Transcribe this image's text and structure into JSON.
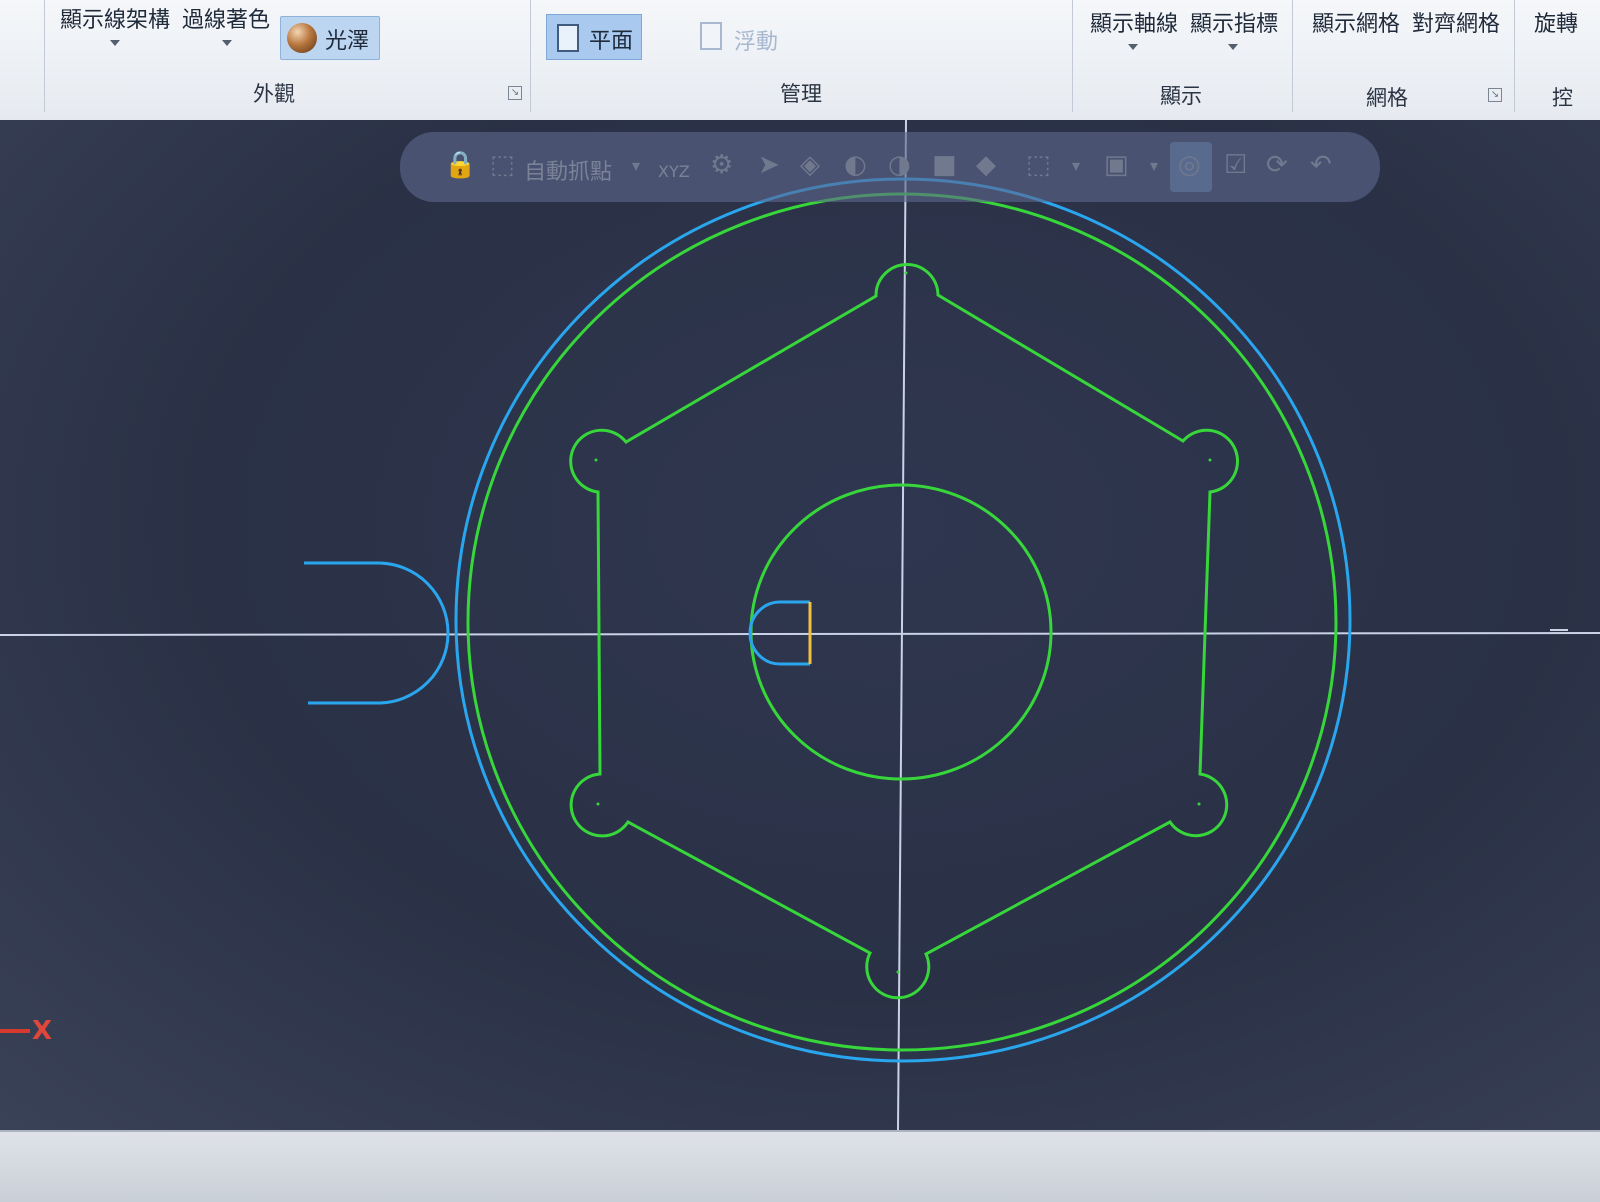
{
  "ribbon": {
    "appearance": {
      "show_wireframe": "顯示線架構",
      "edge_shading": "過線著色",
      "gloss": "光澤",
      "group_label": "外觀"
    },
    "manage": {
      "plane": "平面",
      "floating": "浮動",
      "group_label": "管理"
    },
    "display": {
      "show_axes": "顯示軸線",
      "show_pointer": "顯示指標",
      "group_label": "顯示"
    },
    "grid": {
      "show_grid": "顯示網格",
      "align_grid": "對齊網格",
      "group_label": "網格"
    },
    "rotate": {
      "label": "旋轉",
      "group_label_partial": "控"
    }
  },
  "toolbar": {
    "auto_snap": "自動抓點",
    "xyz": "XYZ"
  },
  "viewport": {
    "axis_label": "X",
    "colors": {
      "green_geometry": "#37d63a",
      "blue_geometry": "#2aa6ef",
      "axis_lines": "#c9d2e6",
      "axis_x_indicator": "#e0463a",
      "background": "#2e3446"
    }
  }
}
